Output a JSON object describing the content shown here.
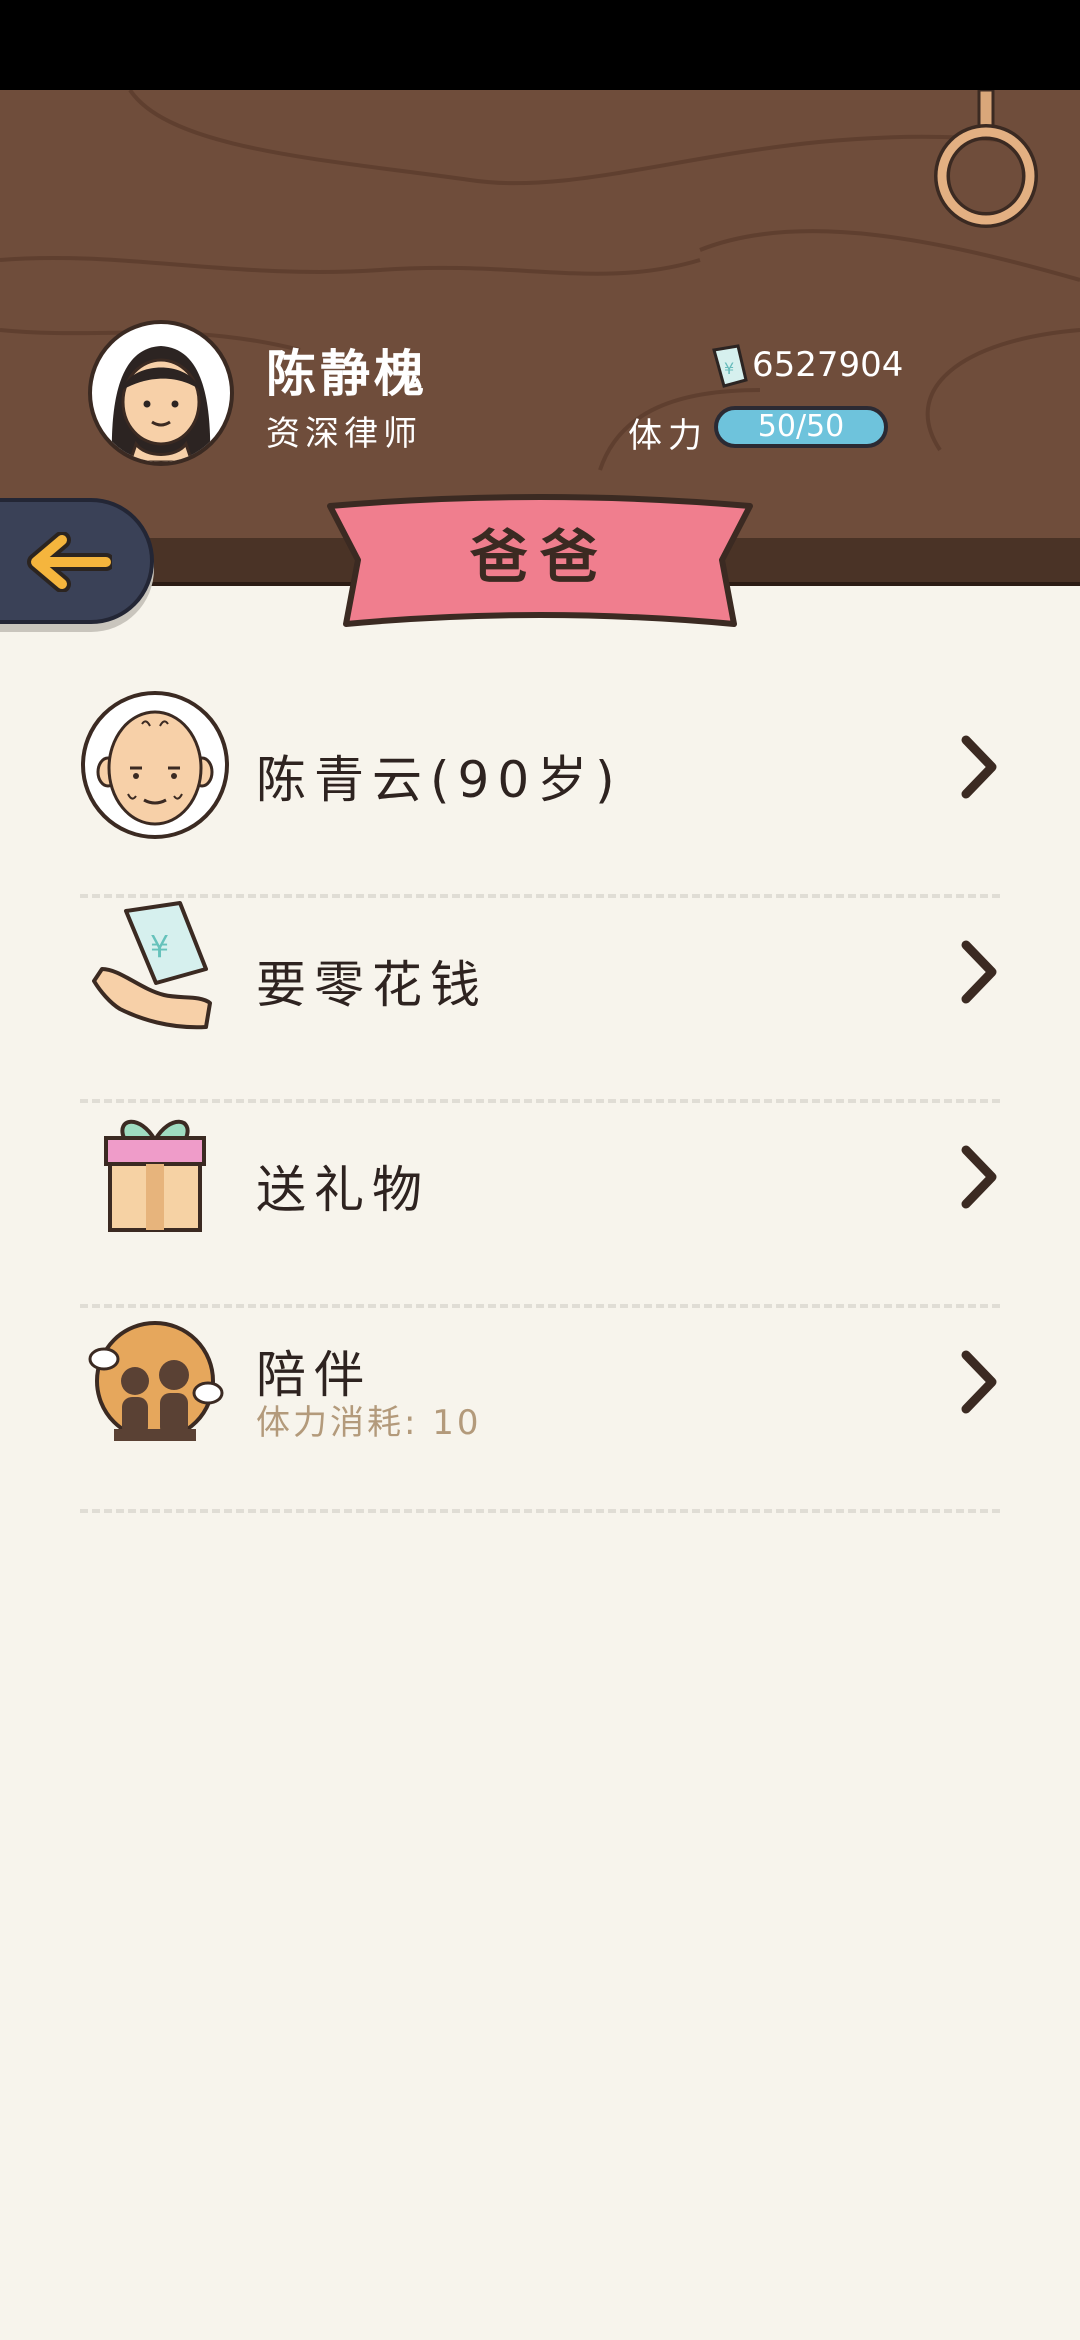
{
  "profile": {
    "name": "陈静槐",
    "occupation": "资深律师",
    "money": "6527904",
    "stamina_label": "体力",
    "stamina_value": "50/50"
  },
  "page": {
    "title": "爸爸"
  },
  "menu": [
    {
      "label": "陈青云(90岁)",
      "icon": "old-man-avatar-icon"
    },
    {
      "label": "要零花钱",
      "icon": "money-hand-icon"
    },
    {
      "label": "送礼物",
      "icon": "gift-box-icon"
    },
    {
      "label": "陪伴",
      "sublabel": "体力消耗: 10",
      "icon": "companion-icon"
    }
  ],
  "colors": {
    "header_wood": "#6f4d3b",
    "banner_pink": "#f07e8e",
    "stamina_blue": "#6ec3dc",
    "back_button": "#3a4157"
  }
}
